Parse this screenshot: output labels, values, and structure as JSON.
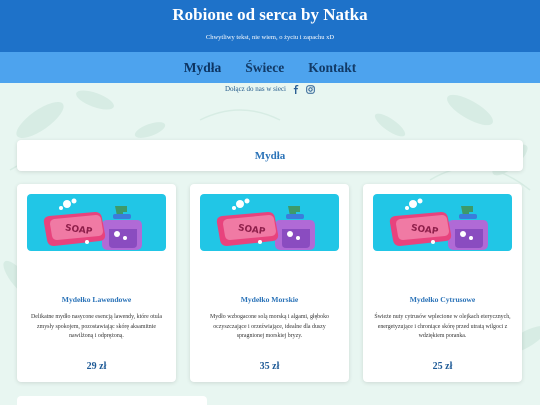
{
  "header": {
    "title": "Robione od serca by Natka",
    "subtitle": "Chwytliwy tekst, nie wiem, o życiu i zapachu xD"
  },
  "nav": {
    "items": [
      {
        "label": "Mydła",
        "active": true
      },
      {
        "label": "Świece",
        "active": false
      },
      {
        "label": "Kontakt",
        "active": false
      }
    ]
  },
  "social": {
    "label": "Dołącz do nas w sieci",
    "icons": [
      "facebook-icon",
      "instagram-icon"
    ]
  },
  "section": {
    "title": "Mydła"
  },
  "products": [
    {
      "name": "Mydełko Lawendowe",
      "description": "Delikatne mydło nasycone esencją lawendy, które otula zmysły spokojem, pozostawiając skórę aksamitnie nawilżoną i odprężoną.",
      "price": "29 zł",
      "image_icon": "soap-icon"
    },
    {
      "name": "Mydełko Morskie",
      "description": "Mydło wzbogacone solą morską i algami, głęboko oczyszczające i orzeźwiające, idealne dla duszy spragnionej morskiej bryzy.",
      "price": "35 zł",
      "image_icon": "soap-icon"
    },
    {
      "name": "Mydełko Cytrusowe",
      "description": "Świeże nuty cytrusów wplecione w olejkach eterycznych, energetyzujące i chroniące skórę przed utratą wilgoci z wdziękiem poranka.",
      "price": "25 zł",
      "image_icon": "soap-icon"
    }
  ],
  "colors": {
    "header_bg": "#1e72c9",
    "nav_bg": "#4da3ee",
    "accent": "#2b73b8",
    "page_bg": "#e8f6f1",
    "image_bg": "#21c6e6"
  }
}
